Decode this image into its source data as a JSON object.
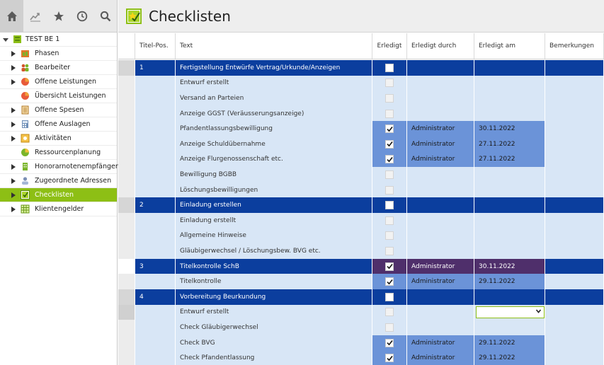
{
  "window": {
    "title": "Checklisten"
  },
  "iconbar": [
    {
      "name": "home-icon",
      "active": true
    },
    {
      "name": "chart-icon",
      "active": false
    },
    {
      "name": "star-icon",
      "active": false
    },
    {
      "name": "clock-icon",
      "active": false
    },
    {
      "name": "search-icon",
      "active": false
    }
  ],
  "tree": {
    "root": "TEST BE 1",
    "items": [
      {
        "label": "Phasen",
        "icon": "phasen-icon",
        "expandable": true
      },
      {
        "label": "Bearbeiter",
        "icon": "users-icon",
        "expandable": true
      },
      {
        "label": "Offene Leistungen",
        "icon": "pie-icon",
        "expandable": true
      },
      {
        "label": "Übersicht Leistungen",
        "icon": "pie-icon",
        "expandable": false
      },
      {
        "label": "Offene Spesen",
        "icon": "receipt-icon",
        "expandable": true
      },
      {
        "label": "Offene Auslagen",
        "icon": "calculator-icon",
        "expandable": true
      },
      {
        "label": "Aktivitäten",
        "icon": "activity-icon",
        "expandable": true
      },
      {
        "label": "Ressourcenplanung",
        "icon": "resource-icon",
        "expandable": false
      },
      {
        "label": "Honorarnotenempfänger",
        "icon": "building-icon",
        "expandable": true
      },
      {
        "label": "Zugeordnete Adressen",
        "icon": "contact-icon",
        "expandable": true
      },
      {
        "label": "Checklisten",
        "icon": "checklist-icon",
        "expandable": true,
        "selected": true
      },
      {
        "label": "Klientengelder",
        "icon": "table-icon",
        "expandable": true
      }
    ]
  },
  "grid": {
    "columns": [
      "Titel-Pos.",
      "Text",
      "Erledigt",
      "Erledigt durch",
      "Erledigt am",
      "Bemerkungen"
    ],
    "rows": [
      {
        "pos": "1",
        "text": "Fertigstellung Entwürfe Vertrag/Urkunde/Anzeigen",
        "checked": false,
        "by": "",
        "date": "",
        "kind": "main"
      },
      {
        "pos": "",
        "text": "Entwurf erstellt",
        "checked": false,
        "by": "",
        "date": "",
        "kind": "sub"
      },
      {
        "pos": "",
        "text": "Versand an Parteien",
        "checked": false,
        "by": "",
        "date": "",
        "kind": "sub"
      },
      {
        "pos": "",
        "text": "Anzeige GGST (Veräusserungsanzeige)",
        "checked": false,
        "by": "",
        "date": "",
        "kind": "sub"
      },
      {
        "pos": "",
        "text": "Pfandentlassungsbewilligung",
        "checked": true,
        "by": "Administrator",
        "date": "30.11.2022",
        "kind": "sub"
      },
      {
        "pos": "",
        "text": "Anzeige Schuldübernahme",
        "checked": true,
        "by": "Administrator",
        "date": "27.11.2022",
        "kind": "sub"
      },
      {
        "pos": "",
        "text": "Anzeige Flurgenossenschaft etc.",
        "checked": true,
        "by": "Administrator",
        "date": "27.11.2022",
        "kind": "sub"
      },
      {
        "pos": "",
        "text": "Bewilligung BGBB",
        "checked": false,
        "by": "",
        "date": "",
        "kind": "sub"
      },
      {
        "pos": "",
        "text": "Löschungsbewilligungen",
        "checked": false,
        "by": "",
        "date": "",
        "kind": "sub"
      },
      {
        "pos": "2",
        "text": "Einladung erstellen",
        "checked": false,
        "by": "",
        "date": "",
        "kind": "main"
      },
      {
        "pos": "",
        "text": "Einladung erstellt",
        "checked": false,
        "by": "",
        "date": "",
        "kind": "sub"
      },
      {
        "pos": "",
        "text": "Allgemeine Hinweise",
        "checked": false,
        "by": "",
        "date": "",
        "kind": "sub"
      },
      {
        "pos": "",
        "text": "Gläubigerwechsel / Löschungsbew. BVG etc.",
        "checked": false,
        "by": "",
        "date": "",
        "kind": "sub"
      },
      {
        "pos": "3",
        "text": "Titelkontrolle SchB",
        "checked": true,
        "by": "Administrator",
        "date": "30.11.2022",
        "kind": "purple"
      },
      {
        "pos": "",
        "text": "Titelkontrolle",
        "checked": true,
        "by": "Administrator",
        "date": "29.11.2022",
        "kind": "sub"
      },
      {
        "pos": "4",
        "text": "Vorbereitung Beurkundung",
        "checked": false,
        "by": "",
        "date": "",
        "kind": "main"
      },
      {
        "pos": "",
        "text": "Entwurf erstellt",
        "checked": false,
        "by": "",
        "date": "",
        "kind": "sub",
        "active": true
      },
      {
        "pos": "",
        "text": "Check Gläubigerwechsel",
        "checked": false,
        "by": "",
        "date": "",
        "kind": "sub"
      },
      {
        "pos": "",
        "text": "Check BVG",
        "checked": true,
        "by": "Administrator",
        "date": "29.11.2022",
        "kind": "sub"
      },
      {
        "pos": "",
        "text": "Check Pfandentlassung",
        "checked": true,
        "by": "Administrator",
        "date": "29.11.2022",
        "kind": "sub"
      }
    ]
  },
  "colors": {
    "accent": "#8dbf15",
    "main_row": "#0b3e9e",
    "sub_row": "#d8e6f6",
    "done_cell": "#6b93d8",
    "purple_cell": "#4f2f6b"
  }
}
